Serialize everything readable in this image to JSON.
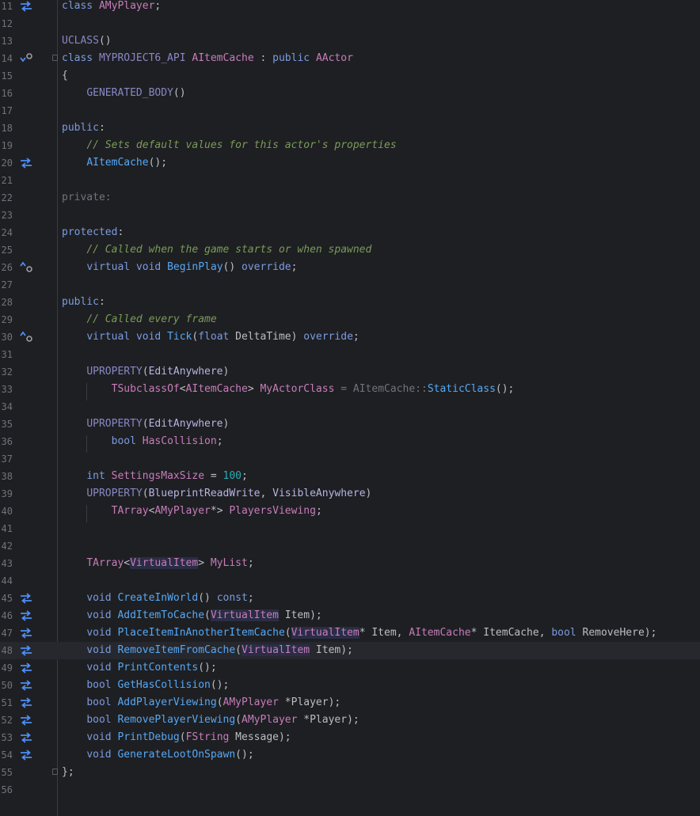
{
  "editor": {
    "lines": [
      {
        "n": "11",
        "gutter": "impl",
        "tokens": [
          [
            "kwb",
            "class"
          ],
          [
            "t",
            " "
          ],
          [
            "cls",
            "AMyPlayer"
          ],
          [
            "t",
            ";"
          ]
        ]
      },
      {
        "n": "12",
        "gutter": "",
        "tokens": []
      },
      {
        "n": "13",
        "gutter": "",
        "tokens": [
          [
            "macro",
            "UCLASS"
          ],
          [
            "t",
            "()"
          ]
        ]
      },
      {
        "n": "14",
        "gutter": "subclass",
        "fold": true,
        "tokens": [
          [
            "kwb",
            "class"
          ],
          [
            "t",
            " "
          ],
          [
            "macro",
            "MYPROJECT6_API"
          ],
          [
            "t",
            " "
          ],
          [
            "cls",
            "AItemCache"
          ],
          [
            "t",
            " : "
          ],
          [
            "kwb",
            "public"
          ],
          [
            "t",
            " "
          ],
          [
            "cls",
            "AActor"
          ]
        ]
      },
      {
        "n": "15",
        "gutter": "",
        "tokens": [
          [
            "t",
            "{"
          ]
        ]
      },
      {
        "n": "16",
        "gutter": "",
        "tokens": [
          [
            "t",
            "    "
          ],
          [
            "macro",
            "GENERATED_BODY"
          ],
          [
            "t",
            "()"
          ]
        ]
      },
      {
        "n": "17",
        "gutter": "",
        "tokens": []
      },
      {
        "n": "18",
        "gutter": "",
        "tokens": [
          [
            "kwb",
            "public"
          ],
          [
            "t",
            ":"
          ]
        ]
      },
      {
        "n": "19",
        "gutter": "",
        "tokens": [
          [
            "t",
            "    "
          ],
          [
            "cm",
            "// Sets default values for this actor's properties"
          ]
        ]
      },
      {
        "n": "20",
        "gutter": "impl",
        "tokens": [
          [
            "t",
            "    "
          ],
          [
            "fn",
            "AItemCache"
          ],
          [
            "t",
            "();"
          ]
        ]
      },
      {
        "n": "21",
        "gutter": "",
        "tokens": []
      },
      {
        "n": "22",
        "gutter": "",
        "tokens": [
          [
            "grey",
            "private:"
          ]
        ]
      },
      {
        "n": "23",
        "gutter": "",
        "tokens": []
      },
      {
        "n": "24",
        "gutter": "",
        "tokens": [
          [
            "kwb",
            "protected"
          ],
          [
            "t",
            ":"
          ]
        ]
      },
      {
        "n": "25",
        "gutter": "",
        "tokens": [
          [
            "t",
            "    "
          ],
          [
            "cm",
            "// Called when the game starts or when spawned"
          ]
        ]
      },
      {
        "n": "26",
        "gutter": "override",
        "tokens": [
          [
            "t",
            "    "
          ],
          [
            "kwb",
            "virtual"
          ],
          [
            "t",
            " "
          ],
          [
            "kwb",
            "void"
          ],
          [
            "t",
            " "
          ],
          [
            "fn",
            "BeginPlay"
          ],
          [
            "t",
            "() "
          ],
          [
            "kwb",
            "override"
          ],
          [
            "t",
            ";"
          ]
        ]
      },
      {
        "n": "27",
        "gutter": "",
        "tokens": []
      },
      {
        "n": "28",
        "gutter": "",
        "tokens": [
          [
            "kwb",
            "public"
          ],
          [
            "t",
            ":"
          ]
        ]
      },
      {
        "n": "29",
        "gutter": "",
        "tokens": [
          [
            "t",
            "    "
          ],
          [
            "cm",
            "// Called every frame"
          ]
        ]
      },
      {
        "n": "30",
        "gutter": "override",
        "tokens": [
          [
            "t",
            "    "
          ],
          [
            "kwb",
            "virtual"
          ],
          [
            "t",
            " "
          ],
          [
            "kwb",
            "void"
          ],
          [
            "t",
            " "
          ],
          [
            "fn",
            "Tick"
          ],
          [
            "t",
            "("
          ],
          [
            "kwb",
            "float"
          ],
          [
            "t",
            " DeltaTime) "
          ],
          [
            "kwb",
            "override"
          ],
          [
            "t",
            ";"
          ]
        ]
      },
      {
        "n": "31",
        "gutter": "",
        "tokens": []
      },
      {
        "n": "32",
        "gutter": "",
        "tokens": [
          [
            "t",
            "    "
          ],
          [
            "macro",
            "UPROPERTY"
          ],
          [
            "t",
            "("
          ],
          [
            "tp",
            "EditAnywhere"
          ],
          [
            "t",
            ")"
          ]
        ]
      },
      {
        "n": "33",
        "gutter": "",
        "tokens": [
          [
            "t",
            "        "
          ],
          [
            "cls",
            "TSubclassOf"
          ],
          [
            "t",
            "<"
          ],
          [
            "cls",
            "AItemCache"
          ],
          [
            "t",
            "> "
          ],
          [
            "fld",
            "MyActorClass"
          ],
          [
            "t",
            " "
          ],
          [
            "grey",
            "= AItemCache::"
          ],
          [
            "fn",
            "StaticClass"
          ],
          [
            "t",
            "();"
          ]
        ]
      },
      {
        "n": "34",
        "gutter": "",
        "tokens": []
      },
      {
        "n": "35",
        "gutter": "",
        "tokens": [
          [
            "t",
            "    "
          ],
          [
            "macro",
            "UPROPERTY"
          ],
          [
            "t",
            "("
          ],
          [
            "tp",
            "EditAnywhere"
          ],
          [
            "t",
            ")"
          ]
        ]
      },
      {
        "n": "36",
        "gutter": "",
        "tokens": [
          [
            "t",
            "        "
          ],
          [
            "kwb",
            "bool"
          ],
          [
            "t",
            " "
          ],
          [
            "fld",
            "HasCollision"
          ],
          [
            "t",
            ";"
          ]
        ]
      },
      {
        "n": "37",
        "gutter": "",
        "tokens": []
      },
      {
        "n": "38",
        "gutter": "",
        "tokens": [
          [
            "t",
            "    "
          ],
          [
            "kwb",
            "int"
          ],
          [
            "t",
            " "
          ],
          [
            "fld",
            "SettingsMaxSize"
          ],
          [
            "t",
            " = "
          ],
          [
            "num",
            "100"
          ],
          [
            "t",
            ";"
          ]
        ]
      },
      {
        "n": "39",
        "gutter": "",
        "tokens": [
          [
            "t",
            "    "
          ],
          [
            "macro",
            "UPROPERTY"
          ],
          [
            "t",
            "("
          ],
          [
            "tp",
            "BlueprintReadWrite"
          ],
          [
            "t",
            ", "
          ],
          [
            "tp",
            "VisibleAnywhere"
          ],
          [
            "t",
            ")"
          ]
        ]
      },
      {
        "n": "40",
        "gutter": "",
        "tokens": [
          [
            "t",
            "        "
          ],
          [
            "cls",
            "TArray"
          ],
          [
            "t",
            "<"
          ],
          [
            "cls",
            "AMyPlayer"
          ],
          [
            "t",
            "*> "
          ],
          [
            "fld",
            "PlayersViewing"
          ],
          [
            "t",
            ";"
          ]
        ]
      },
      {
        "n": "41",
        "gutter": "",
        "tokens": []
      },
      {
        "n": "42",
        "gutter": "",
        "tokens": []
      },
      {
        "n": "43",
        "gutter": "",
        "tokens": [
          [
            "t",
            "    "
          ],
          [
            "cls",
            "TArray"
          ],
          [
            "t",
            "<"
          ],
          [
            "clshl",
            "VirtualItem"
          ],
          [
            "t",
            "> "
          ],
          [
            "fld",
            "MyList"
          ],
          [
            "t",
            ";"
          ]
        ]
      },
      {
        "n": "44",
        "gutter": "",
        "tokens": []
      },
      {
        "n": "45",
        "gutter": "impl",
        "tokens": [
          [
            "t",
            "    "
          ],
          [
            "kwb",
            "void"
          ],
          [
            "t",
            " "
          ],
          [
            "fn",
            "CreateInWorld"
          ],
          [
            "t",
            "() "
          ],
          [
            "kwb",
            "const"
          ],
          [
            "t",
            ";"
          ]
        ]
      },
      {
        "n": "46",
        "gutter": "impl",
        "tokens": [
          [
            "t",
            "    "
          ],
          [
            "kwb",
            "void"
          ],
          [
            "t",
            " "
          ],
          [
            "fn",
            "AddItemToCache"
          ],
          [
            "t",
            "("
          ],
          [
            "clshl",
            "VirtualItem"
          ],
          [
            "t",
            " Item);"
          ]
        ]
      },
      {
        "n": "47",
        "gutter": "impl",
        "tokens": [
          [
            "t",
            "    "
          ],
          [
            "kwb",
            "void"
          ],
          [
            "t",
            " "
          ],
          [
            "fn",
            "PlaceItemInAnotherItemCache"
          ],
          [
            "t",
            "("
          ],
          [
            "clshl",
            "VirtualItem"
          ],
          [
            "t",
            "* Item, "
          ],
          [
            "cls",
            "AItemCache"
          ],
          [
            "t",
            "* ItemCache, "
          ],
          [
            "kwb",
            "bool"
          ],
          [
            "t",
            " RemoveHere);"
          ]
        ]
      },
      {
        "n": "48",
        "gutter": "impl",
        "current": true,
        "tokens": [
          [
            "t",
            "    "
          ],
          [
            "kwb",
            "void"
          ],
          [
            "t",
            " "
          ],
          [
            "fn",
            "RemoveItemFromCache"
          ],
          [
            "t",
            "("
          ],
          [
            "clshl",
            "VirtualItem"
          ],
          [
            "t",
            " Item);"
          ]
        ]
      },
      {
        "n": "49",
        "gutter": "impl",
        "tokens": [
          [
            "t",
            "    "
          ],
          [
            "kwb",
            "void"
          ],
          [
            "t",
            " "
          ],
          [
            "fn",
            "PrintContents"
          ],
          [
            "t",
            "();"
          ]
        ]
      },
      {
        "n": "50",
        "gutter": "impl",
        "tokens": [
          [
            "t",
            "    "
          ],
          [
            "kwb",
            "bool"
          ],
          [
            "t",
            " "
          ],
          [
            "fn",
            "GetHasCollision"
          ],
          [
            "t",
            "();"
          ]
        ]
      },
      {
        "n": "51",
        "gutter": "impl",
        "tokens": [
          [
            "t",
            "    "
          ],
          [
            "kwb",
            "bool"
          ],
          [
            "t",
            " "
          ],
          [
            "fn",
            "AddPlayerViewing"
          ],
          [
            "t",
            "("
          ],
          [
            "cls",
            "AMyPlayer"
          ],
          [
            "t",
            " *Player);"
          ]
        ]
      },
      {
        "n": "52",
        "gutter": "impl",
        "tokens": [
          [
            "t",
            "    "
          ],
          [
            "kwb",
            "bool"
          ],
          [
            "t",
            " "
          ],
          [
            "fn",
            "RemovePlayerViewing"
          ],
          [
            "t",
            "("
          ],
          [
            "cls",
            "AMyPlayer"
          ],
          [
            "t",
            " *Player);"
          ]
        ]
      },
      {
        "n": "53",
        "gutter": "impl",
        "tokens": [
          [
            "t",
            "    "
          ],
          [
            "kwb",
            "void"
          ],
          [
            "t",
            " "
          ],
          [
            "fn",
            "PrintDebug"
          ],
          [
            "t",
            "("
          ],
          [
            "cls",
            "FString"
          ],
          [
            "t",
            " Message);"
          ]
        ]
      },
      {
        "n": "54",
        "gutter": "impl",
        "tokens": [
          [
            "t",
            "    "
          ],
          [
            "kwb",
            "void"
          ],
          [
            "t",
            " "
          ],
          [
            "fn",
            "GenerateLootOnSpawn"
          ],
          [
            "t",
            "();"
          ]
        ]
      },
      {
        "n": "55",
        "gutter": "",
        "fold": true,
        "tokens": [
          [
            "t",
            "};"
          ]
        ]
      },
      {
        "n": "56",
        "gutter": "",
        "tokens": []
      }
    ]
  },
  "colors": {
    "background": "#1e1f22",
    "gutter_icon": "#4d8ef7",
    "current_line": "#26282e"
  },
  "icons": {
    "impl": "navigate-to-implementation-icon",
    "subclass": "has-subclasses-icon",
    "override": "overrides-method-icon"
  }
}
